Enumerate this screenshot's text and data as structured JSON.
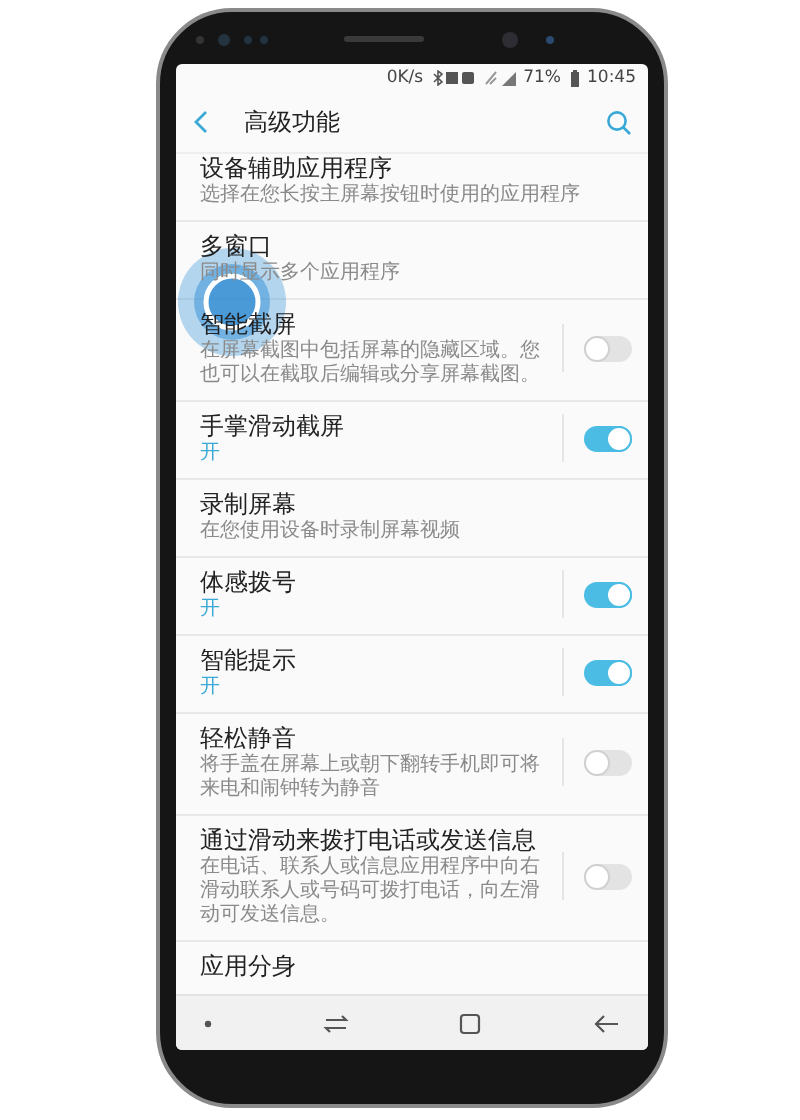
{
  "status_bar": {
    "speed": "0K/s",
    "battery": "71%",
    "time": "10:45"
  },
  "header": {
    "title": "高级功能"
  },
  "items": [
    {
      "kind": "plain",
      "title": "设备辅助应用程序",
      "description": "选择在您长按主屏幕按钮时使用的应用程序"
    },
    {
      "kind": "plain",
      "title": "多窗口",
      "description": "同时显示多个应用程序"
    },
    {
      "kind": "toggle",
      "title": "智能截屏",
      "description": "在屏幕截图中包括屏幕的隐藏区域。您也可以在截取后编辑或分享屏幕截图。",
      "on": false,
      "touched": true
    },
    {
      "kind": "toggle",
      "title": "手掌滑动截屏",
      "status": "开",
      "on": true
    },
    {
      "kind": "plain",
      "title": "录制屏幕",
      "description": "在您使用设备时录制屏幕视频"
    },
    {
      "kind": "toggle",
      "title": "体感拨号",
      "status": "开",
      "on": true
    },
    {
      "kind": "toggle",
      "title": "智能提示",
      "status": "开",
      "on": true
    },
    {
      "kind": "toggle",
      "title": "轻松静音",
      "description": "将手盖在屏幕上或朝下翻转手机即可将来电和闹钟转为静音",
      "on": false
    },
    {
      "kind": "toggle",
      "title": "通过滑动来拨打电话或发送信息",
      "description": "在电话、联系人或信息应用程序中向右滑动联系人或号码可拨打电话，向左滑动可发送信息。",
      "on": false
    },
    {
      "kind": "plain",
      "title": "应用分身"
    }
  ]
}
